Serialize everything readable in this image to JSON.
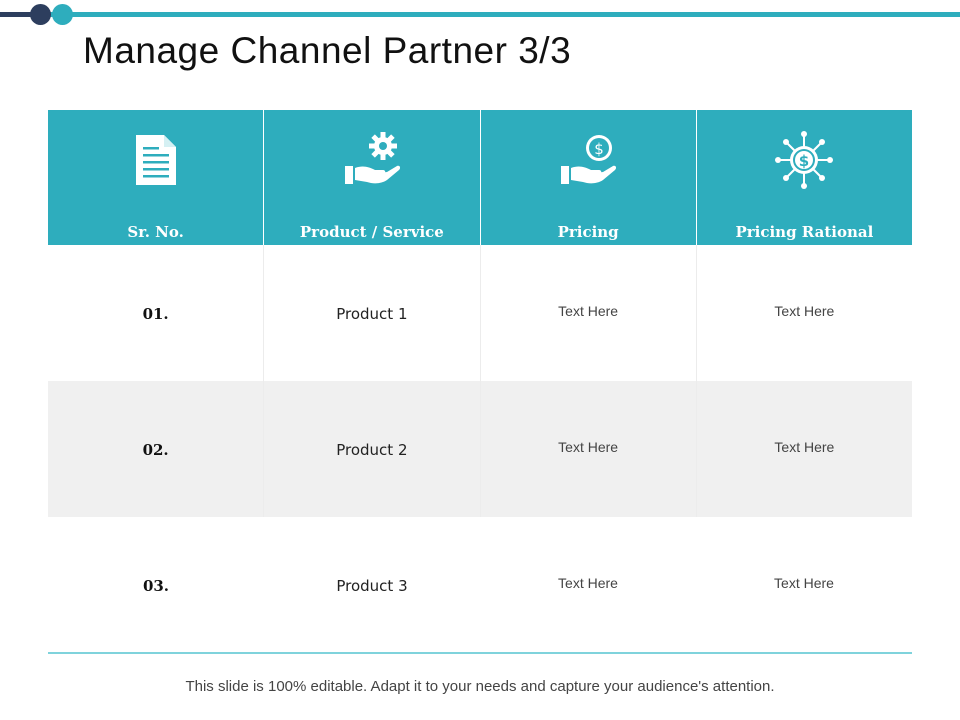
{
  "slide": {
    "title": "Manage Channel Partner 3/3",
    "footer": "This slide is 100% editable. Adapt it to your needs and capture your audience's attention.",
    "accent_color": "#2eadbd",
    "dark_color": "#2d3e5e"
  },
  "table": {
    "headers": [
      {
        "label": "Sr. No.",
        "icon": "document-icon"
      },
      {
        "label": "Product / Service",
        "icon": "hand-gear-icon"
      },
      {
        "label": "Pricing",
        "icon": "hand-coin-icon"
      },
      {
        "label": "Pricing Rational",
        "icon": "dollar-network-icon"
      }
    ],
    "rows": [
      {
        "sr": "01.",
        "product": "Product 1",
        "pricing": "Text Here",
        "rational": "Text Here"
      },
      {
        "sr": "02.",
        "product": "Product 2",
        "pricing": "Text Here",
        "rational": "Text Here"
      },
      {
        "sr": "03.",
        "product": "Product 3",
        "pricing": "Text Here",
        "rational": "Text Here"
      }
    ]
  }
}
